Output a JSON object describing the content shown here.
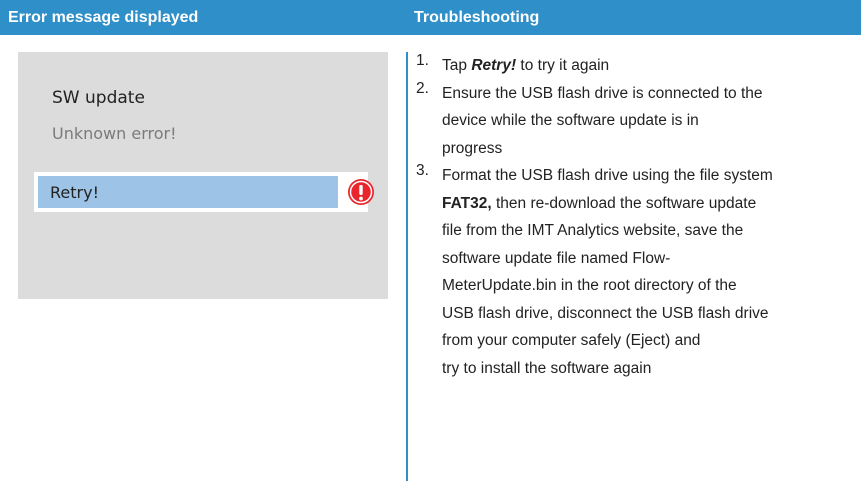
{
  "header": {
    "left_title": "Error message displayed",
    "right_title": "Troubleshooting"
  },
  "colors": {
    "header_bg": "#2f8fc8",
    "panel_bg": "#dcdcdc",
    "retry_bg": "#9dc3e6",
    "error_red": "#e8262b"
  },
  "dialog": {
    "title": "SW update",
    "message": "Unknown error!",
    "retry_label": "Retry!",
    "status_icon": "error-exclamation-icon"
  },
  "steps": [
    {
      "number": "1.",
      "lines": [
        {
          "pre": "Tap ",
          "emph": "Retry!",
          "post": " to try it again"
        }
      ]
    },
    {
      "number": "2.",
      "lines": [
        "Ensure the USB flash drive is connected to the",
        "device while the software update is in",
        "progress"
      ]
    },
    {
      "number": "3.",
      "lines": [
        "Format the USB flash drive using the file   system",
        {
          "bold": "FAT32,",
          "post": " then re-download the software update"
        },
        "file from the IMT Analytics website, save the",
        "software update file named Flow-",
        "MeterUpdate.bin in the root directory of the",
        "USB flash drive, disconnect the USB flash drive",
        "from your computer safely (Eject) and",
        "try to install the software again"
      ]
    }
  ]
}
